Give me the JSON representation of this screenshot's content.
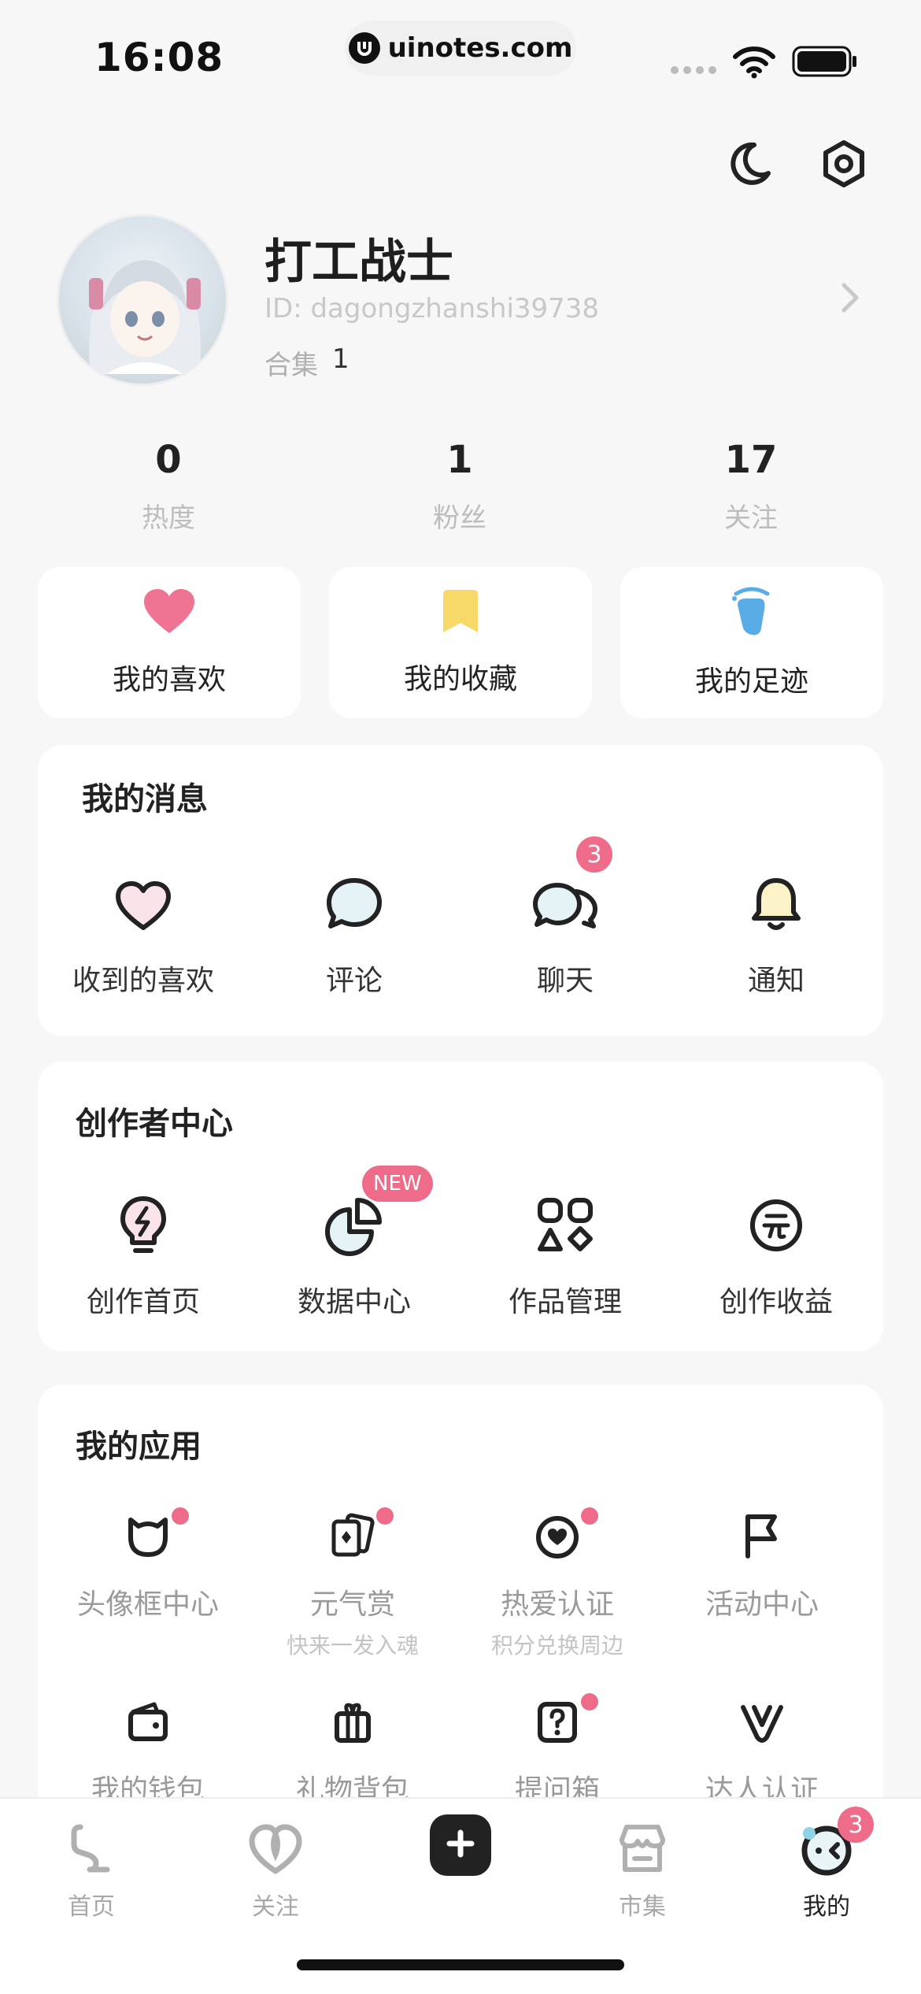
{
  "status_bar": {
    "time": "16:08",
    "url": "uinotes.com"
  },
  "profile": {
    "nickname": "打工战士",
    "user_id": "ID: dagongzhanshi39738",
    "collection_label": "合集",
    "collection_count": "1"
  },
  "stats": [
    {
      "value": "0",
      "label": "热度"
    },
    {
      "value": "1",
      "label": "粉丝"
    },
    {
      "value": "17",
      "label": "关注"
    }
  ],
  "quick_cards": [
    {
      "label": "我的喜欢",
      "icon": "heart-icon",
      "color": "#ef7393"
    },
    {
      "label": "我的收藏",
      "icon": "bookmark-icon",
      "color": "#f7d96a"
    },
    {
      "label": "我的足迹",
      "icon": "footprint-icon",
      "color": "#5aace6"
    }
  ],
  "messages": {
    "title": "我的消息",
    "items": [
      {
        "label": "收到的喜欢",
        "icon": "heart-outline-icon"
      },
      {
        "label": "评论",
        "icon": "comment-icon"
      },
      {
        "label": "聊天",
        "icon": "chat-icon",
        "badge": "3"
      },
      {
        "label": "通知",
        "icon": "bell-icon"
      }
    ]
  },
  "creator": {
    "title": "创作者中心",
    "items": [
      {
        "label": "创作首页",
        "icon": "lightbulb-icon"
      },
      {
        "label": "数据中心",
        "icon": "pie-chart-icon",
        "badge": "NEW"
      },
      {
        "label": "作品管理",
        "icon": "shapes-icon"
      },
      {
        "label": "创作收益",
        "icon": "yuan-coin-icon"
      }
    ]
  },
  "apps": {
    "title": "我的应用",
    "items": [
      {
        "label": "头像框中心",
        "icon": "cat-frame-icon",
        "dot": true
      },
      {
        "label": "元气赏",
        "sub": "快来一发入魂",
        "icon": "cards-icon",
        "dot": true
      },
      {
        "label": "热爱认证",
        "sub": "积分兑换周边",
        "icon": "heart-badge-icon",
        "dot": true
      },
      {
        "label": "活动中心",
        "icon": "flag-icon"
      },
      {
        "label": "我的钱包",
        "icon": "wallet-icon"
      },
      {
        "label": "礼物背包",
        "icon": "gift-icon"
      },
      {
        "label": "提问箱",
        "icon": "question-box-icon",
        "dot": true
      },
      {
        "label": "达人认证",
        "icon": "v-badge-icon"
      }
    ]
  },
  "tabbar": {
    "items": [
      {
        "label": "首页",
        "icon": "home-icon"
      },
      {
        "label": "关注",
        "icon": "follow-heart-icon"
      },
      {
        "label": "市集",
        "icon": "store-icon"
      },
      {
        "label": "我的",
        "icon": "profile-face-icon",
        "badge": "3",
        "active": true
      }
    ]
  },
  "colors": {
    "accent_pink": "#ef6b8a",
    "background": "#f7f7f7"
  }
}
